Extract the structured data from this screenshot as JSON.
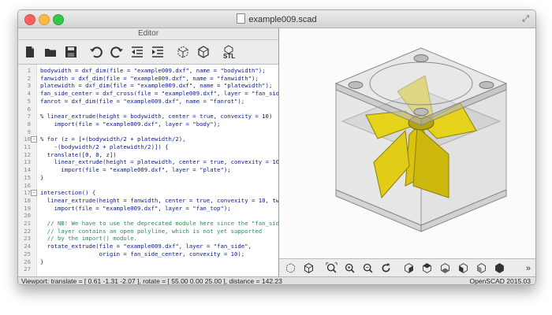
{
  "window": {
    "title": "example009.scad"
  },
  "editor": {
    "header": "Editor",
    "lines": [
      {
        "n": "1",
        "t": "bodywidth = dxf_dim(file = \"example009.dxf\", name = \"bodywidth\");"
      },
      {
        "n": "2",
        "t": "fanwidth = dxf_dim(file = \"example009.dxf\", name = \"fanwidth\");"
      },
      {
        "n": "3",
        "t": "platewidth = dxf_dim(file = \"example009.dxf\", name = \"platewidth\");"
      },
      {
        "n": "4",
        "t": "fan_side_center = dxf_cross(file = \"example009.dxf\", layer = \"fan_side_center\");"
      },
      {
        "n": "5",
        "t": "fanrot = dxf_dim(file = \"example009.dxf\", name = \"fanrot\");"
      },
      {
        "n": "6",
        "t": ""
      },
      {
        "n": "7",
        "t": "% linear_extrude(height = bodywidth, center = true, convexity = 10)"
      },
      {
        "n": "8",
        "t": "    import(file = \"example009.dxf\", layer = \"body\");"
      },
      {
        "n": "9",
        "t": ""
      },
      {
        "n": "10",
        "t": "% for (z = [+(bodywidth/2 + platewidth/2),"
      },
      {
        "n": "11",
        "t": "    -(bodywidth/2 + platewidth/2)]) {"
      },
      {
        "n": "12",
        "t": "  translate([0, 0, z])"
      },
      {
        "n": "13",
        "t": "    linear_extrude(height = platewidth, center = true, convexity = 10)"
      },
      {
        "n": "14",
        "t": "      import(file = \"example009.dxf\", layer = \"plate\");"
      },
      {
        "n": "15",
        "t": "}"
      },
      {
        "n": "16",
        "t": ""
      },
      {
        "n": "17",
        "t": "intersection() {"
      },
      {
        "n": "18",
        "t": "  linear_extrude(height = fanwidth, center = true, convexity = 10, twist = -fanrot)"
      },
      {
        "n": "19",
        "t": "    import(file = \"example009.dxf\", layer = \"fan_top\");"
      },
      {
        "n": "20",
        "t": ""
      },
      {
        "n": "21",
        "t": "  // NB! We have to use the deprecated module here since the \"fan_side\""
      },
      {
        "n": "22",
        "t": "  // layer contains an open polyline, which is not yet supported"
      },
      {
        "n": "23",
        "t": "  // by the import() module."
      },
      {
        "n": "24",
        "t": "  rotate_extrude(file = \"example009.dxf\", layer = \"fan_side\","
      },
      {
        "n": "25",
        "t": "                 origin = fan_side_center, convexity = 10);"
      },
      {
        "n": "26",
        "t": "}"
      },
      {
        "n": "27",
        "t": ""
      }
    ]
  },
  "toolbar": {
    "stl_label": "STL",
    "icons": [
      "new-file-icon",
      "open-folder-icon",
      "save-icon",
      "undo-icon",
      "redo-icon",
      "unindent-icon",
      "indent-icon",
      "preview-icon",
      "render-icon",
      "export-stl-icon"
    ]
  },
  "view_toolbar": {
    "icons": [
      "preview-icon",
      "render-icon",
      "zoom-all-icon",
      "zoom-in-icon",
      "zoom-out-icon",
      "reset-view-icon",
      "view-right-icon",
      "view-top-icon",
      "view-bottom-icon",
      "view-left-icon",
      "view-front-icon",
      "view-back-icon"
    ],
    "more": "»"
  },
  "status": {
    "viewport": "Viewport: translate = [ 0.61 -1.31 -2.07 ], rotate = [ 55.00 0.00 25.00 ], distance = 142.23",
    "version": "OpenSCAD 2015.03"
  },
  "colors": {
    "fan": "#e5d21b",
    "fan_dark": "#8f7f08",
    "body": "#c9c9c9"
  }
}
